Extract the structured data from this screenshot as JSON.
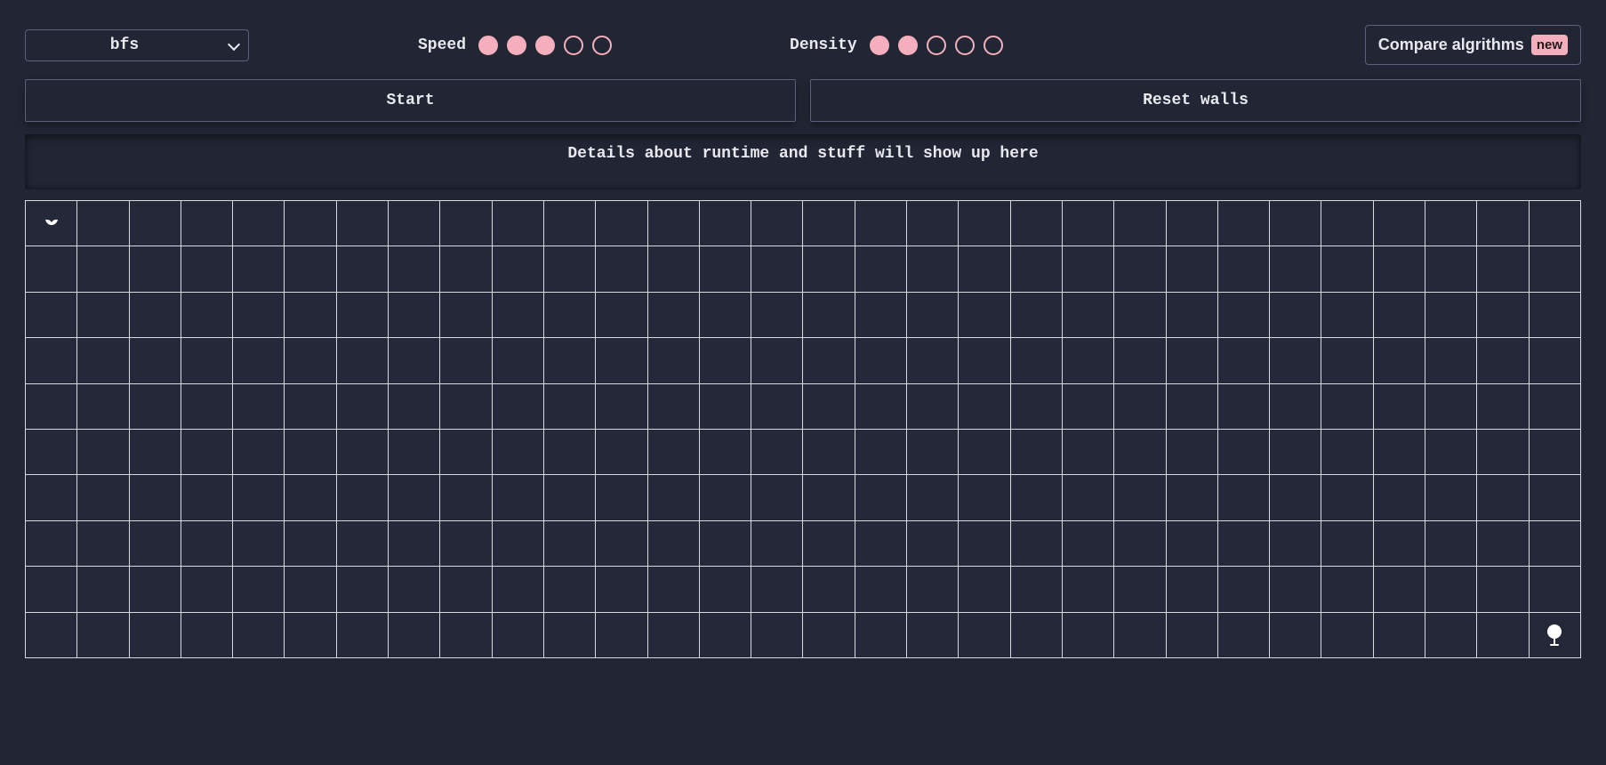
{
  "controls": {
    "algorithm_selected": "bfs",
    "speed_label": "Speed",
    "speed_total": 5,
    "speed_filled": 3,
    "density_label": "Density",
    "density_total": 5,
    "density_filled": 2,
    "compare_label": "Compare algrithms",
    "compare_badge": "new"
  },
  "actions": {
    "start_label": "Start",
    "reset_label": "Reset walls"
  },
  "details": {
    "placeholder": "Details about runtime and stuff will show up here"
  },
  "grid": {
    "rows": 10,
    "cols": 30,
    "start_cell": {
      "row": 0,
      "col": 0
    },
    "end_cell": {
      "row": 9,
      "col": 29
    }
  },
  "colors": {
    "bg": "#222634",
    "border": "#5a6077",
    "text": "#e8e9ef",
    "accent_pink": "#f4aebc",
    "grid_line": "#d8d8df",
    "cell_bg": "#242838"
  }
}
